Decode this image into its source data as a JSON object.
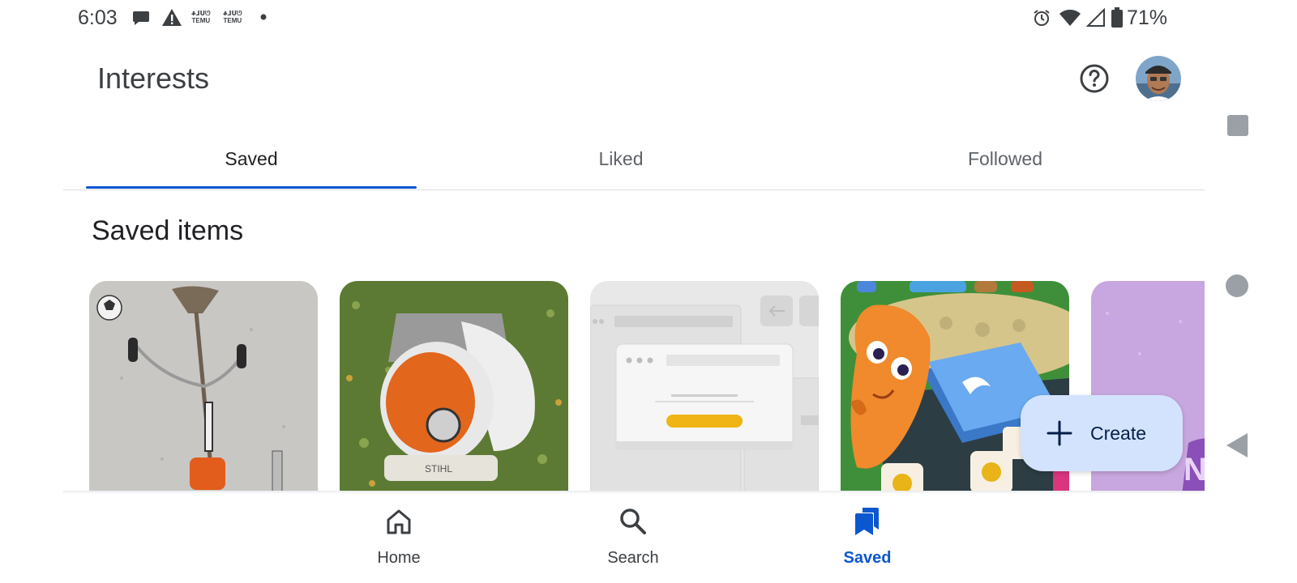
{
  "status_bar": {
    "time": "6:03",
    "notification_icons": [
      "chat-bubble-icon",
      "warning-icon",
      "temu-icon",
      "temu-icon",
      "dot-icon"
    ],
    "temu_label_top": "ቆᒧᑌᘎ",
    "temu_label_bottom": "TEMU",
    "system_icons": [
      "alarm-icon",
      "wifi-icon",
      "signal-icon",
      "battery-icon"
    ],
    "battery": "71%"
  },
  "header": {
    "title": "Interests",
    "help_icon": "help-icon",
    "avatar": "avatar"
  },
  "tabs": [
    {
      "label": "Saved",
      "active": true
    },
    {
      "label": "Liked",
      "active": false
    },
    {
      "label": "Followed",
      "active": false
    }
  ],
  "section": {
    "title": "Saved items"
  },
  "cards": [
    {
      "name": "string-trimmer-image"
    },
    {
      "name": "leaf-blower-image"
    },
    {
      "name": "browser-placeholder-image"
    },
    {
      "name": "game-image"
    },
    {
      "name": "purple-portrait-image"
    }
  ],
  "fab": {
    "label": "Create",
    "icon": "plus-icon"
  },
  "bottom_nav": [
    {
      "label": "Home",
      "icon": "home-icon",
      "active": false
    },
    {
      "label": "Search",
      "icon": "search-icon",
      "active": false
    },
    {
      "label": "Saved",
      "icon": "bookmarks-icon",
      "active": true
    }
  ],
  "system_nav": [
    "recents-button",
    "home-button",
    "back-button"
  ],
  "colors": {
    "accent": "#0b57d0",
    "fab_background": "#d3e3fd",
    "divider": "#dadce0"
  }
}
